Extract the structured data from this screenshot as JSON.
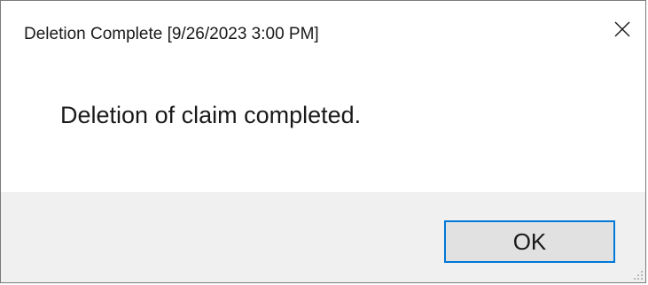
{
  "window": {
    "title": "Deletion Complete [9/26/2023 3:00 PM]"
  },
  "message": {
    "text": "Deletion of claim completed."
  },
  "buttons": {
    "ok_label": "OK"
  },
  "icons": {
    "close": "close-icon",
    "size_grip": "size-grip-icon"
  },
  "colors": {
    "footer_background": "#f0f0f0",
    "button_focus_border": "#0078d7",
    "button_face": "#e1e1e1"
  }
}
